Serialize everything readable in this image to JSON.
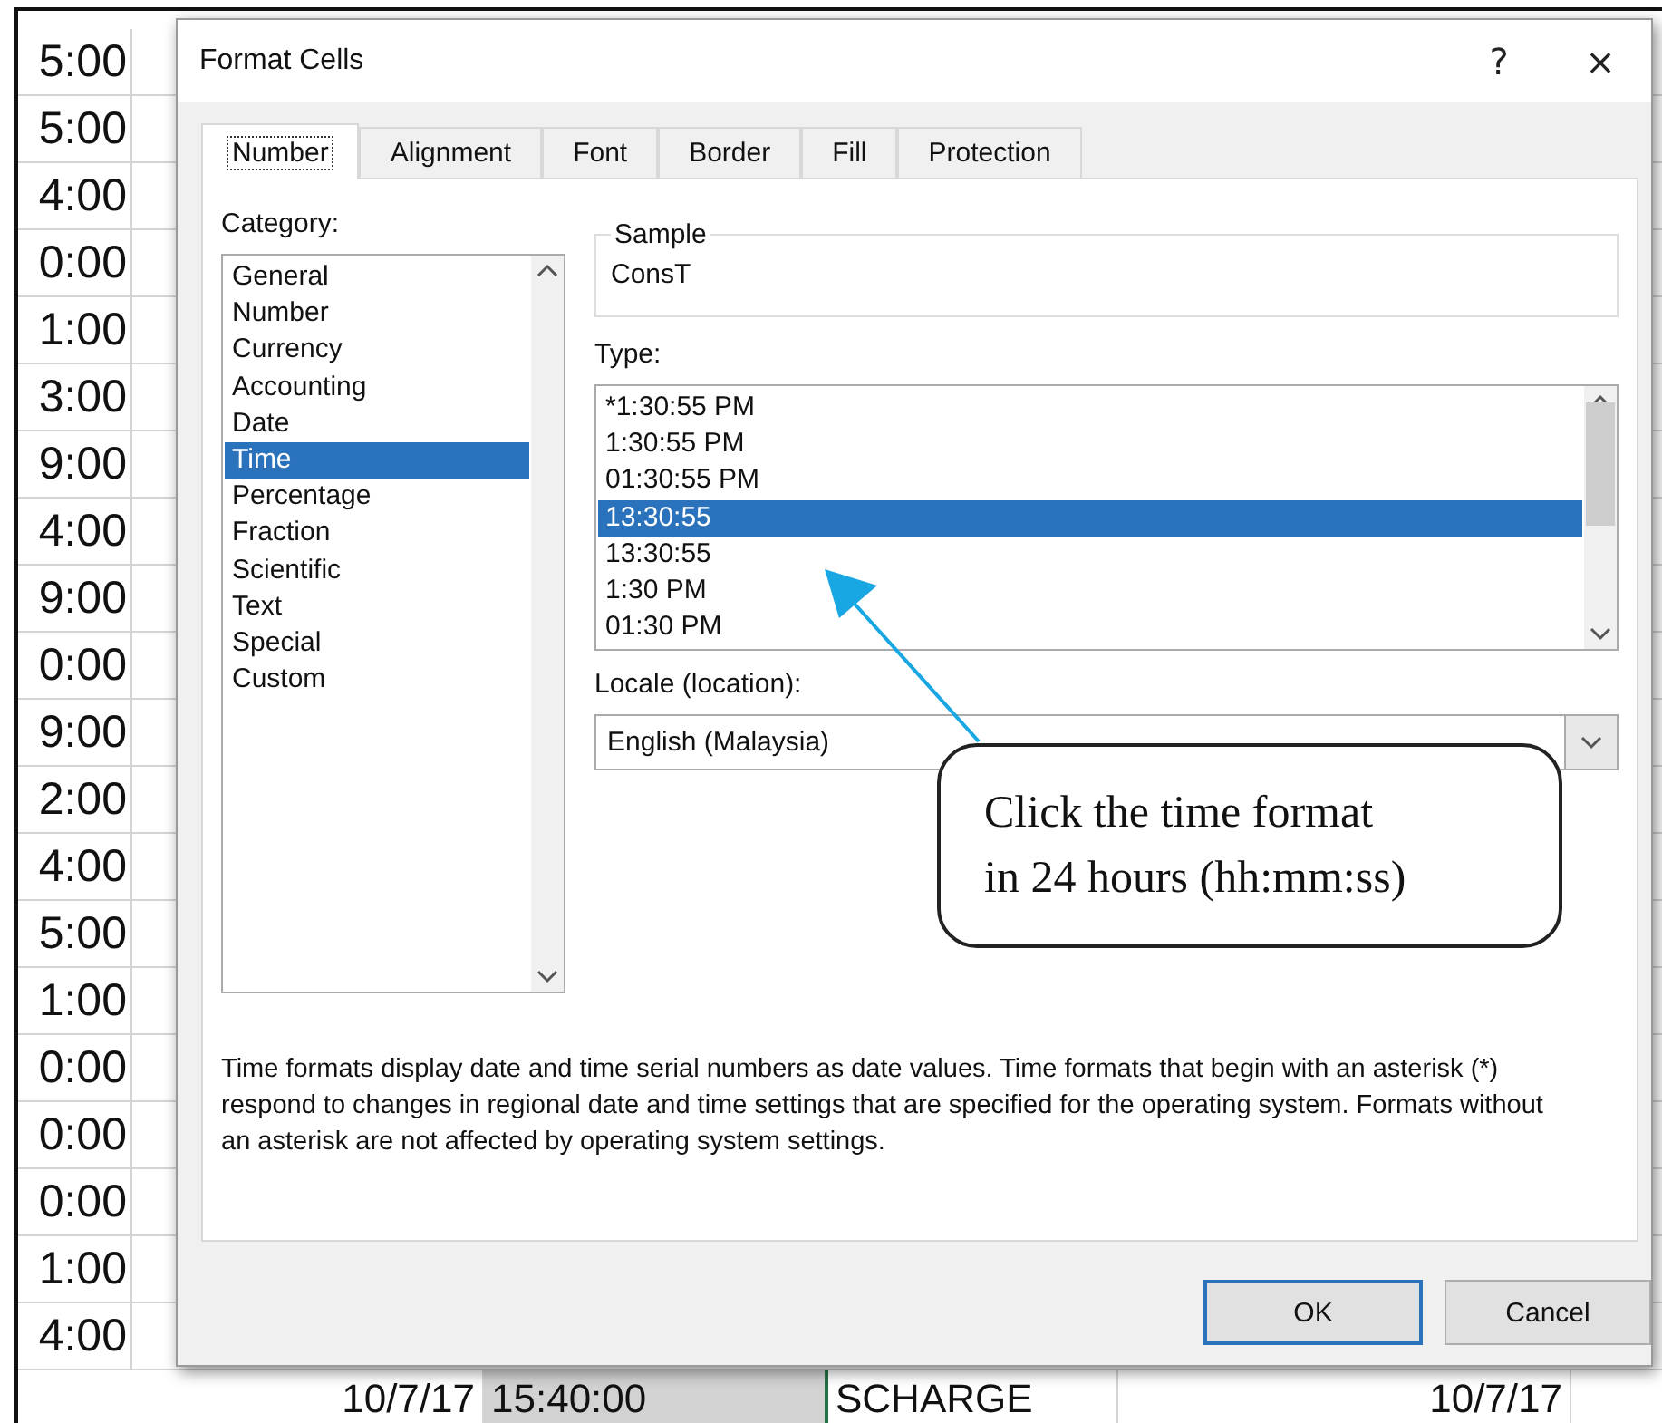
{
  "spreadsheet": {
    "time_column": [
      "5:00",
      "5:00",
      "4:00",
      "0:00",
      "1:00",
      "3:00",
      "9:00",
      "4:00",
      "9:00",
      "0:00",
      "9:00",
      "2:00",
      "4:00",
      "5:00",
      "1:00",
      "0:00",
      "0:00",
      "0:00",
      "1:00",
      "4:00"
    ],
    "bottom_row": [
      {
        "text": "10/7/17",
        "selected": false
      },
      {
        "text": "15:40:00",
        "selected": true
      },
      {
        "text": "SCHARGE",
        "selected": false
      },
      {
        "text": "10/7/17",
        "selected": false
      }
    ]
  },
  "dialog": {
    "title": "Format Cells",
    "help": "?",
    "close": "×",
    "tabs": [
      {
        "label": "Number",
        "selected": true
      },
      {
        "label": "Alignment",
        "selected": false
      },
      {
        "label": "Font",
        "selected": false
      },
      {
        "label": "Border",
        "selected": false
      },
      {
        "label": "Fill",
        "selected": false
      },
      {
        "label": "Protection",
        "selected": false
      }
    ],
    "category": {
      "label": "Category:",
      "items": [
        {
          "label": "General",
          "selected": false
        },
        {
          "label": "Number",
          "selected": false
        },
        {
          "label": "Currency",
          "selected": false
        },
        {
          "label": "Accounting",
          "selected": false
        },
        {
          "label": "Date",
          "selected": false
        },
        {
          "label": "Time",
          "selected": true
        },
        {
          "label": "Percentage",
          "selected": false
        },
        {
          "label": "Fraction",
          "selected": false
        },
        {
          "label": "Scientific",
          "selected": false
        },
        {
          "label": "Text",
          "selected": false
        },
        {
          "label": "Special",
          "selected": false
        },
        {
          "label": "Custom",
          "selected": false
        }
      ]
    },
    "sample": {
      "label": "Sample",
      "value": "ConsT"
    },
    "type": {
      "label": "Type:",
      "items": [
        {
          "label": "*1:30:55 PM",
          "selected": false
        },
        {
          "label": "1:30:55 PM",
          "selected": false
        },
        {
          "label": "01:30:55 PM",
          "selected": false
        },
        {
          "label": "13:30:55",
          "selected": true
        },
        {
          "label": "13:30:55",
          "selected": false
        },
        {
          "label": "1:30 PM",
          "selected": false
        },
        {
          "label": "01:30 PM",
          "selected": false
        }
      ]
    },
    "locale": {
      "label": "Locale (location):",
      "value": "English (Malaysia)"
    },
    "description": "Time formats display date and time serial numbers as date values.  Time formats that begin with an asterisk (*) respond to changes in regional date and time settings that are specified for the operating system. Formats without an asterisk are not affected by operating system settings.",
    "buttons": [
      {
        "label": "OK",
        "default": true
      },
      {
        "label": "Cancel",
        "default": false
      }
    ]
  },
  "callout": {
    "lines": [
      "Click the time format",
      "in 24 hours (hh:mm:ss)"
    ]
  }
}
